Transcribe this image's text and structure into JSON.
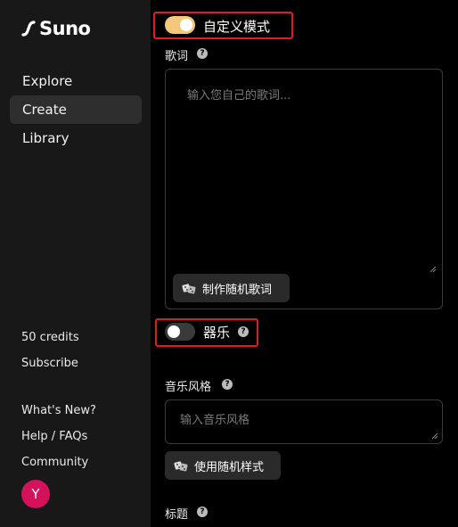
{
  "app": {
    "name": "Suno"
  },
  "sidebar": {
    "nav": [
      {
        "label": "Explore"
      },
      {
        "label": "Create",
        "active": true
      },
      {
        "label": "Library"
      }
    ],
    "credits": "50 credits",
    "subscribe": "Subscribe",
    "links": [
      {
        "label": "What's New?"
      },
      {
        "label": "Help / FAQs"
      },
      {
        "label": "Community"
      }
    ],
    "avatar_initial": "Y"
  },
  "main": {
    "custom_mode": {
      "label": "自定义模式",
      "on": true
    },
    "lyrics": {
      "label": "歌词",
      "placeholder": "输入您自己的歌词...",
      "random_button": "制作随机歌词"
    },
    "instrumental": {
      "label": "器乐",
      "on": false
    },
    "style": {
      "label": "音乐风格",
      "placeholder": "输入音乐风格",
      "random_button": "使用随机样式"
    },
    "title": {
      "label": "标题"
    }
  },
  "colors": {
    "sidebar_bg": "#181818",
    "toggle_on": "#f5c77a",
    "highlight_box": "#e11b22",
    "avatar": "#d6115b"
  }
}
